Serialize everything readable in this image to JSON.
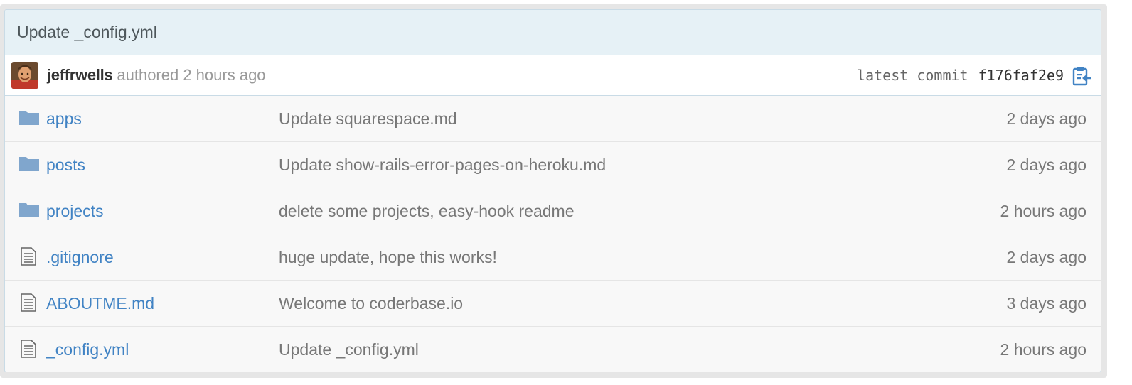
{
  "commit": {
    "message": "Update _config.yml",
    "author": "jeffrwells",
    "authored_text": "authored 2 hours ago",
    "latest_label": "latest commit",
    "sha": "f176faf2e9"
  },
  "files": [
    {
      "name": "apps",
      "type": "folder",
      "message": "Update squarespace.md",
      "age": "2 days ago"
    },
    {
      "name": "posts",
      "type": "folder",
      "message": "Update show-rails-error-pages-on-heroku.md",
      "age": "2 days ago"
    },
    {
      "name": "projects",
      "type": "folder",
      "message": "delete some projects, easy-hook readme",
      "age": "2 hours ago"
    },
    {
      "name": ".gitignore",
      "type": "file",
      "message": "huge update, hope this works!",
      "age": "2 days ago"
    },
    {
      "name": "ABOUTME.md",
      "type": "file",
      "message": "Welcome to coderbase.io",
      "age": "3 days ago"
    },
    {
      "name": "_config.yml",
      "type": "file",
      "message": "Update _config.yml",
      "age": "2 hours ago"
    }
  ],
  "colors": {
    "link": "#4183c4",
    "folder_icon": "#80a6cd",
    "header_bg": "#e6f1f6"
  },
  "icons": {
    "folder": "folder-icon",
    "file": "file-text-icon",
    "clipboard": "clipboard-icon"
  }
}
